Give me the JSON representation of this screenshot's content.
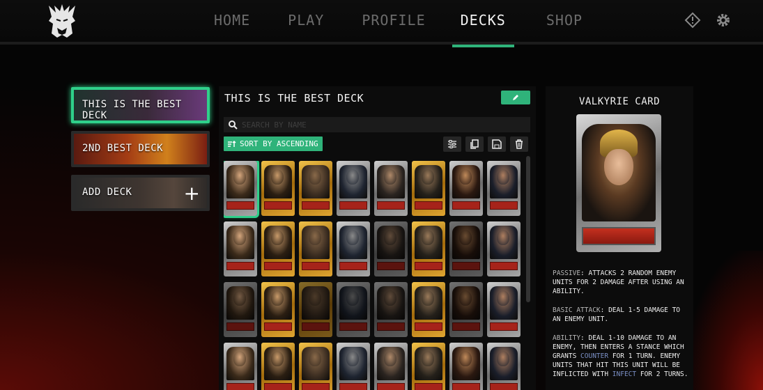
{
  "nav": {
    "items": [
      {
        "label": "HOME"
      },
      {
        "label": "PLAY"
      },
      {
        "label": "PROFILE"
      },
      {
        "label": "DECKS"
      },
      {
        "label": "SHOP"
      }
    ],
    "active": "DECKS"
  },
  "decks": {
    "items": [
      {
        "label": "THIS IS THE BEST DECK"
      },
      {
        "label": "2ND BEST DECK"
      }
    ],
    "add_label": "ADD DECK"
  },
  "editor": {
    "title": "THIS IS THE BEST DECK",
    "search_placeholder": "SEARCH BY NAME",
    "sort_label": "SORT BY ASCENDING"
  },
  "cards": [
    "silver",
    "gold",
    "gold",
    "silver",
    "silver",
    "gold",
    "silver",
    "silver",
    "silver",
    "gold",
    "gold",
    "silver",
    "silver",
    "gold",
    "silver",
    "silver",
    "silver",
    "gold",
    "gold",
    "silver",
    "silver",
    "gold",
    "silver",
    "silver",
    "silver",
    "gold",
    "gold",
    "silver",
    "silver",
    "gold",
    "silver",
    "silver"
  ],
  "detail": {
    "title": "VALKYRIE CARD",
    "passive_key": "PASSIVE",
    "passive_text": ": ATTACKS 2 RANDOM ENEMY UNITS FOR 2 DAMAGE AFTER USING AN ABILITY.",
    "basic_key": "BASIC ATTACK",
    "basic_text": ": DEAL 1-5 DAMAGE TO AN ENEMY UNIT.",
    "ability_key": "ABILITY",
    "ability_text_1": ": DEAL 1-10 DAMAGE TO AN ENEMY, THEN ENTERS A STANCE WHICH GRANTS ",
    "ability_counter": "COUNTER",
    "ability_text_2": " FOR 1 TURN. ENEMY UNITS THAT HIT THIS UNIT WILL BE INFLICTED WITH ",
    "ability_infect": "INFECT",
    "ability_text_3": " FOR 2 TURNS."
  },
  "colors": {
    "accent": "#2fb37a",
    "card_plate": "#a6231a"
  }
}
